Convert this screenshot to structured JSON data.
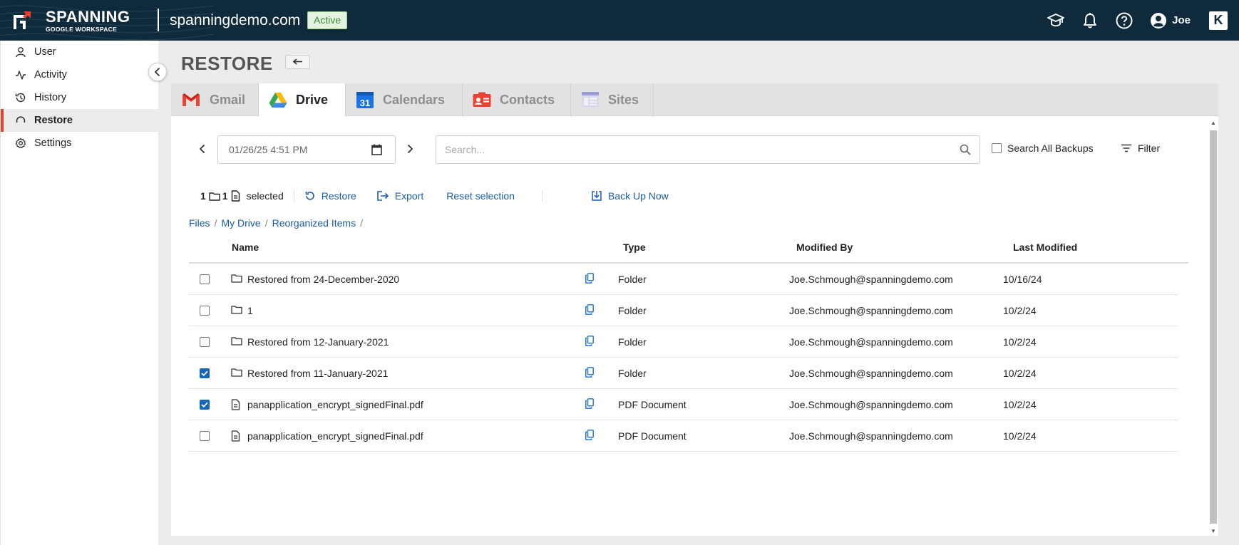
{
  "brand": {
    "name": "SPANNING",
    "sub": "GOOGLE WORKSPACE"
  },
  "header": {
    "domain": "spanningdemo.com",
    "status": "Active",
    "user": "Joe",
    "k_badge": "K",
    "icons": [
      "graduation-cap-icon",
      "bell-icon",
      "help-icon",
      "user-avatar-icon"
    ]
  },
  "sidebar": {
    "items": [
      {
        "label": "User",
        "icon": "user-icon"
      },
      {
        "label": "Activity",
        "icon": "activity-icon"
      },
      {
        "label": "History",
        "icon": "history-icon"
      },
      {
        "label": "Restore",
        "icon": "restore-icon",
        "active": true
      },
      {
        "label": "Settings",
        "icon": "gear-icon"
      }
    ]
  },
  "page": {
    "title": "RESTORE"
  },
  "tabs": [
    {
      "label": "Gmail",
      "icon": "gmail-icon"
    },
    {
      "label": "Drive",
      "icon": "drive-icon",
      "active": true
    },
    {
      "label": "Calendars",
      "icon": "calendar-icon",
      "icon_text": "31"
    },
    {
      "label": "Contacts",
      "icon": "contacts-icon"
    },
    {
      "label": "Sites",
      "icon": "sites-icon"
    }
  ],
  "toolbar": {
    "date": "01/26/25 4:51 PM",
    "search_placeholder": "Search...",
    "search_all_label": "Search All Backups",
    "filter_label": "Filter"
  },
  "selection": {
    "folders": "1",
    "files": "1",
    "label": "selected",
    "restore": "Restore",
    "export": "Export",
    "reset": "Reset selection",
    "backup_now": "Back Up Now"
  },
  "breadcrumb": [
    "Files",
    "My Drive",
    "Reorganized Items"
  ],
  "table": {
    "headers": {
      "name": "Name",
      "type": "Type",
      "modified_by": "Modified By",
      "last_modified": "Last Modified"
    },
    "rows": [
      {
        "checked": false,
        "kind": "folder",
        "name": "Restored from 24-December-2020",
        "type": "Folder",
        "modified_by": "Joe.Schmough@spanningdemo.com",
        "last_modified": "10/16/24"
      },
      {
        "checked": false,
        "kind": "folder",
        "name": "1",
        "type": "Folder",
        "modified_by": "Joe.Schmough@spanningdemo.com",
        "last_modified": "10/2/24"
      },
      {
        "checked": false,
        "kind": "folder",
        "name": "Restored from 12-January-2021",
        "type": "Folder",
        "modified_by": "Joe.Schmough@spanningdemo.com",
        "last_modified": "10/2/24"
      },
      {
        "checked": true,
        "kind": "folder",
        "name": "Restored from 11-January-2021",
        "type": "Folder",
        "modified_by": "Joe.Schmough@spanningdemo.com",
        "last_modified": "10/2/24"
      },
      {
        "checked": true,
        "kind": "file",
        "name": "panapplication_encrypt_signedFinal.pdf",
        "type": "PDF Document",
        "modified_by": "Joe.Schmough@spanningdemo.com",
        "last_modified": "10/2/24"
      },
      {
        "checked": false,
        "kind": "file",
        "name": "panapplication_encrypt_signedFinal.pdf",
        "type": "PDF Document",
        "modified_by": "Joe.Schmough@spanningdemo.com",
        "last_modified": "10/2/24"
      }
    ]
  },
  "colors": {
    "header_bg": "#0e2a3b",
    "accent": "#e0452f",
    "link": "#1a5da6",
    "check": "#1665b7"
  }
}
